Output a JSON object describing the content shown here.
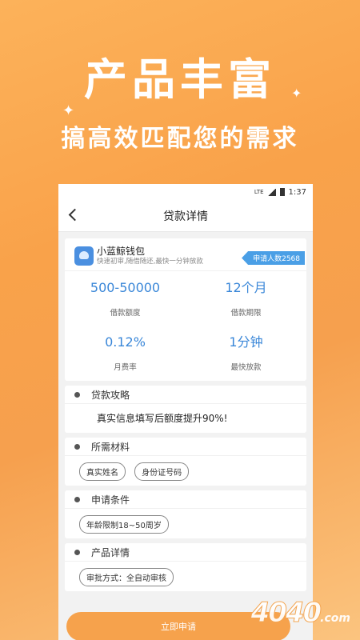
{
  "hero": {
    "title": "产品丰富",
    "subtitle": "搞高效匹配您的需求"
  },
  "status_bar": {
    "network": "LTE",
    "time": "1:37"
  },
  "nav": {
    "title": "贷款详情"
  },
  "product": {
    "name": "小蓝鲸钱包",
    "description": "快速初审,随借随还,最快一分钟放款",
    "apply_count": "申请人数2568",
    "stats": [
      {
        "value": "500-50000",
        "label": "借款额度"
      },
      {
        "value": "12个月",
        "label": "借款期限"
      },
      {
        "value": "0.12%",
        "label": "月费率"
      },
      {
        "value": "1分钟",
        "label": "最快放款"
      }
    ]
  },
  "sections": {
    "strategy": {
      "title": "贷款攻略",
      "body": "真实信息填写后额度提升90%!"
    },
    "materials": {
      "title": "所需材料",
      "tags": [
        "真实姓名",
        "身份证号码"
      ]
    },
    "conditions": {
      "title": "申请条件",
      "tags": [
        "年龄限制18~50周岁"
      ]
    },
    "details": {
      "title": "产品详情",
      "tags": [
        "审批方式：全自动审核"
      ]
    }
  },
  "apply_button": "立即申请",
  "watermark": {
    "text": "4040",
    "suffix": ".com"
  },
  "colors": {
    "accent": "#3a87d8",
    "background": "#f9a24a",
    "button": "#f6a24c"
  }
}
